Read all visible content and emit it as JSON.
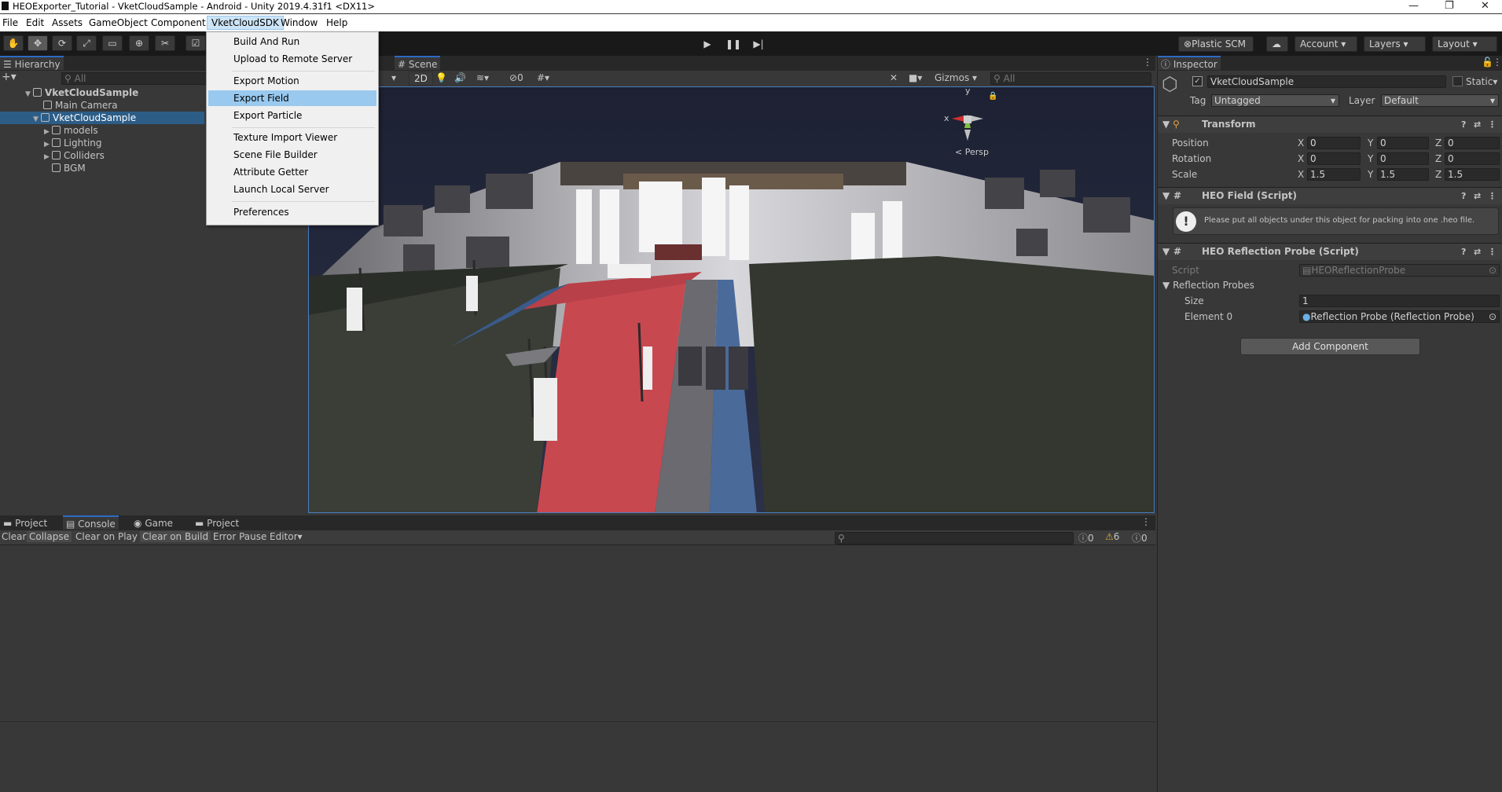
{
  "window": {
    "title": "HEOExporter_Tutorial - VketCloudSample - Android - Unity 2019.4.31f1 <DX11>"
  },
  "menu": [
    "File",
    "Edit",
    "Assets",
    "GameObject",
    "Component",
    "VketCloudSDK",
    "Window",
    "Help"
  ],
  "dropdown": {
    "items": [
      "Build And Run",
      "Upload to Remote Server",
      "Export Motion",
      "Export Field",
      "Export Particle",
      "Texture Import Viewer",
      "Scene File Builder",
      "Attribute Getter",
      "Launch Local Server",
      "Preferences"
    ],
    "highlighted": "Export Field"
  },
  "toolbar": {
    "plastic": "Plastic SCM",
    "account": "Account",
    "layers": "Layers",
    "layout": "Layout"
  },
  "hierarchy": {
    "tab": "Hierarchy",
    "search": "All",
    "rows": [
      "VketCloudSample",
      "Main Camera",
      "VketCloudSample",
      "models",
      "Lighting",
      "Colliders",
      "BGM"
    ]
  },
  "scene": {
    "tab": "Scene",
    "mode2d": "2D",
    "hidden_count": "0",
    "gizmos": "Gizmos",
    "search": "All",
    "persp": "< Persp",
    "axis_y": "y",
    "axis_x": "x"
  },
  "console": {
    "tabs": [
      "Project",
      "Console",
      "Game",
      "Project"
    ],
    "buttons": [
      "Clear",
      "Collapse",
      "Clear on Play",
      "Clear on Build",
      "Error Pause",
      "Editor"
    ],
    "counts": {
      "info": "0",
      "warn": "6",
      "error": "0"
    }
  },
  "inspector": {
    "tab": "Inspector",
    "name": "VketCloudSample",
    "static": "Static",
    "tag_label": "Tag",
    "tag": "Untagged",
    "layer_label": "Layer",
    "layer": "Default",
    "transform": {
      "title": "Transform",
      "position_label": "Position",
      "rotation_label": "Rotation",
      "scale_label": "Scale",
      "position": [
        "0",
        "0",
        "0"
      ],
      "rotation": [
        "0",
        "0",
        "0"
      ],
      "scale": [
        "1.5",
        "1.5",
        "1.5"
      ]
    },
    "heo_field": {
      "title": "HEO Field (Script)",
      "message": "Please put all objects under this object for packing into one .heo file."
    },
    "heo_probe": {
      "title": "HEO Reflection Probe (Script)",
      "script_label": "Script",
      "script": "HEOReflectionProbe",
      "probes_label": "Reflection Probes",
      "size_label": "Size",
      "size": "1",
      "element_label": "Element 0",
      "element": "Reflection Probe (Reflection Probe)"
    },
    "add_component": "Add Component"
  },
  "axis_labels": {
    "x": "X",
    "y": "Y",
    "z": "Z"
  }
}
